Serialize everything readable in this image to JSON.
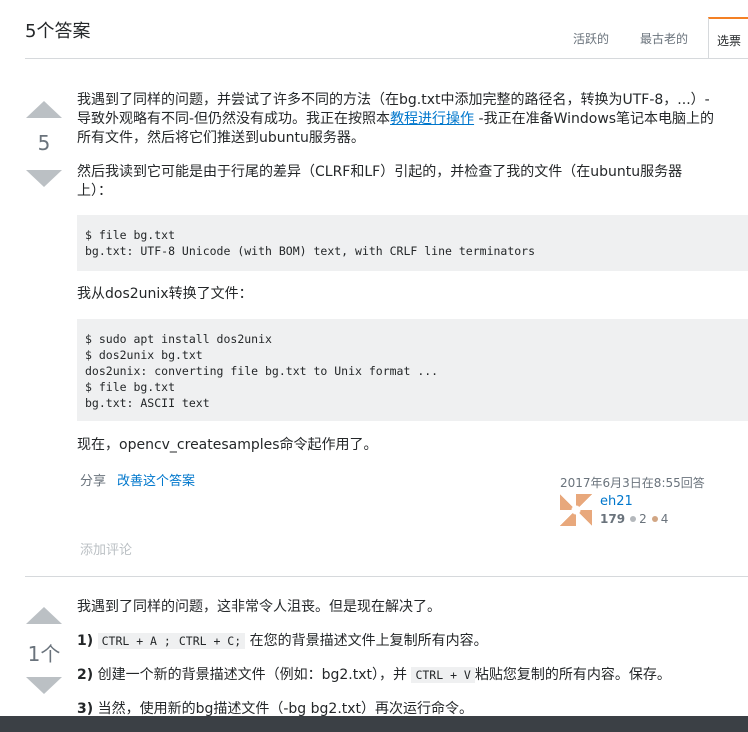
{
  "header": {
    "title": "5个答案",
    "tabs": [
      {
        "label": "活跃的"
      },
      {
        "label": "最古老的"
      },
      {
        "label": "选票"
      }
    ]
  },
  "answers": [
    {
      "votes": "5",
      "p1_line1": "我遇到了同样的问题，并尝试了许多不同的方法（在bg.txt中添加完整的路径名，转换为UTF-8，...）-",
      "p1_line2": "导致外观略有不同-但仍然没有成功。我正在按照本",
      "p1_link": "教程进行操作",
      "p1_line2_end": "-我正在准备Windows笔记本电脑上的",
      "p1_line3": "所有文件，然后将它们推送到ubuntu服务器。",
      "p2_line1": "然后我读到它可能是由于行尾的差异（CLRF和LF）引起的，并检查了我的文件（在ubuntu服务器",
      "p2_line2": "上）：",
      "code1": "$ file bg.txt\nbg.txt: UTF-8 Unicode (with BOM) text, with CRLF line terminators",
      "p3": "我从dos2unix转换了文件：",
      "code2": "$ sudo apt install dos2unix\n$ dos2unix bg.txt\ndos2unix: converting file bg.txt to Unix format ...\n$ file bg.txt\nbg.txt: ASCII text",
      "p4": "现在，opencv_createsamples命令起作用了。",
      "share": "分享",
      "improve": "改善这个答案",
      "answered": "2017年6月3日在8:55回答",
      "user": "eh21",
      "rep": "179",
      "silver": "2",
      "bronze": "4",
      "add_comment": "添加评论"
    },
    {
      "votes": "1个",
      "intro": "我遇到了同样的问题，这非常令人沮丧。但是现在解决了。",
      "s1_num": "1)",
      "s1_kbd1": "CTRL + A ;",
      "s1_kbd2": "CTRL + C;",
      "s1_text": "在您的背景描述文件上复制所有内容。",
      "s2_num": "2)",
      "s2_text_a": "创建一个新的背景描述文件（例如：bg2.txt），并",
      "s2_kbd": "CTRL + V",
      "s2_text_b": "粘贴您复制的所有内容。保存。",
      "s3_num": "3)",
      "s3_text": "当然，使用新的bg描述文件（-bg bg2.txt）再次运行命令。"
    }
  ],
  "colors": {
    "link": "#0077cc",
    "tab_accent": "#f48024",
    "silver": "#b4b8bc",
    "bronze": "#d1a684"
  }
}
